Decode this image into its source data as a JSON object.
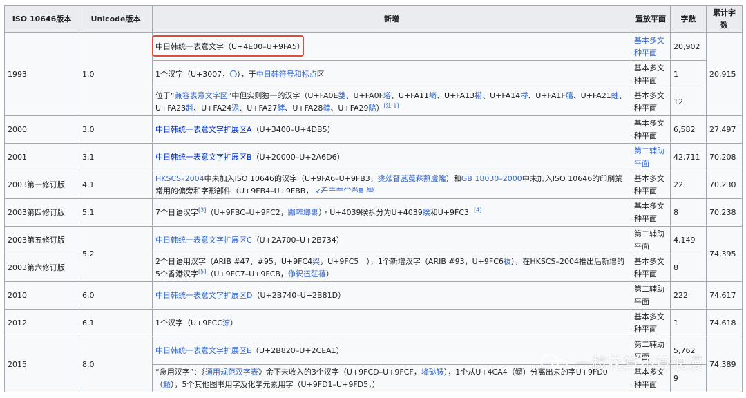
{
  "headers": [
    "ISO 10646版本",
    "Unicode版本",
    "新增",
    "置放平面",
    "字数",
    "累计字数"
  ],
  "rows": {
    "r1": {
      "iso": "1993",
      "uni": "1.0",
      "desc": "中日韩统一表意文字（U+4E00–U+9FA5）",
      "plane": "基本多文种平面",
      "count": "20,902",
      "cum": "20,915"
    },
    "r2": {
      "desc_a": "1个汉字（U+3007，",
      "circle": "〇",
      "desc_b": "），于",
      "link": "中日韩符号和标点",
      "desc_c": "区",
      "plane": "基本多文种平面",
      "count": "1"
    },
    "r3": {
      "desc_a": "位于“",
      "link": "兼容表意文字区",
      "desc_b": "”中但实则独一的汉字（U+FA0E",
      "c1": "﨎",
      "desc_c": "、U+FA0F",
      "c2": "﨏",
      "desc_d": "、U+FA11",
      "c3": "﨑",
      "desc_e": "、U+FA13",
      "c4": "﨓",
      "desc_f": "、U+FA14",
      "c5": "﨔",
      "desc_g": "、U+FA1F",
      "c6": "﨟",
      "desc_h": "、U+FA21",
      "c7": "﨡",
      "desc_i": "、U+FA23",
      "c8": "﨣",
      "desc_j": "、U+FA24",
      "c9": "﨤",
      "desc_k": "、U+FA27",
      "c10": "﨧",
      "desc_l": "、U+FA28",
      "c11": "﨨",
      "desc_m": "、U+FA29",
      "c12": "﨩",
      "desc_n": "）",
      "note": "[注 1]",
      "plane": "基本多文种平面",
      "count": "12"
    },
    "r4": {
      "iso": "2000",
      "uni": "3.0",
      "link": "中日韩统一表意文字扩展区A",
      "desc": "（U+3400–U+4DB5）",
      "plane": "基本多文种平面",
      "count": "6,582",
      "cum": "27,497"
    },
    "r5": {
      "iso": "2001",
      "uni": "3.1",
      "link": "中日韩统一表意文字扩展区B",
      "desc": "（U+20000–U+2A6D6）",
      "plane": "第二辅助平面",
      "count": "42,711",
      "cum": "70,208"
    },
    "r6": {
      "iso": "2003第一修订版",
      "uni": "4.1",
      "link1": "HKSCS–2004",
      "desc_a": "中未加入ISO 10646的汉字（U+9FA6–U+9FB3，",
      "chars": "㷭㿰䀾䓵䒶䔉䖄䖒䧯",
      "desc_b": "）和",
      "link2": "GB 18030–2000",
      "desc_c": "中未加入ISO 10646的印刷業常用的偏旁和字形部件（U+9FB4–U+9FBB，",
      "chars2": "龴龵龶龷龸龹龺龻",
      "plane": "基本多文种平面",
      "count": "22",
      "cum": "70,230"
    },
    "r7": {
      "iso": "2003第四修订版",
      "uni": "5.1",
      "desc_a": "7个日语汉字",
      "sup1": "[3]",
      "desc_b": "（U+9FBC–U+9FC2，",
      "chars": "鿼鿽鿾鿿",
      "desc_c": "），U+4039睽拆分为U+4039",
      "c1": "睽",
      "desc_d": "和U+9FC3",
      "sup2": "[4]",
      "plane": "基本多文种平面",
      "count": "8",
      "cum": "70,238"
    },
    "r8": {
      "iso": "2003第五修订版",
      "uni": "5.2",
      "link": "中日韩统一表意文字扩展区C",
      "desc": "（U+2A700–U+2B734）",
      "plane": "第二辅助平面",
      "count": "4,149",
      "cum": "74,395"
    },
    "r9": {
      "iso": "2003第六修订版",
      "desc_a": "2个日语用汉字（ARIB #47、#95，U+9FC4",
      "c1": "鿄",
      "desc_b": "，U+9FC5　），1个新增汉字（ARIB #93，U+9FC6",
      "c2": "鿆",
      "desc_c": "），在HKSCS–2004推出后新增的5个香港汉字",
      "sup": "[5]",
      "desc_d": "（U+9FC7–U+9FCB，",
      "chars": "鿇鿈鿉鿊鿋",
      "desc_e": "）",
      "plane": "基本多文种平面",
      "count": "8"
    },
    "r10": {
      "iso": "2010",
      "uni": "6.0",
      "link": "中日韩统一表意文字扩展区D",
      "desc": "（U+2B740–U+2B81D）",
      "plane": "第二辅助平面",
      "count": "222",
      "cum": "74,617"
    },
    "r11": {
      "iso": "2012",
      "uni": "6.1",
      "desc_a": "1个汉字（U+9FCC",
      "c1": "鿌",
      "desc_b": "）",
      "plane": "基本多文种平面",
      "count": "1",
      "cum": "74,618"
    },
    "r12": {
      "iso": "2015",
      "uni": "8.0",
      "link": "中日韩统一表意文字扩展区E",
      "desc": "（U+2B820–U+2CEA1）",
      "plane": "第二辅助平面",
      "count": "5,762",
      "cum": "74,389"
    },
    "r13": {
      "desc_a": "“急用汉字”：《",
      "link": "通用规范汉字表",
      "desc_b": "》余下未收入的3个汉字（U+9FCD–U+9FCF，",
      "chars": "鿍鿎鿏",
      "desc_c": "），1个从U+4CA4（䲤）分离出来的字U+9FD0（",
      "c1": "鿐",
      "desc_d": "），5个其他图书用字及化学元素用字（U+9FD1–U+9FD5，",
      "desc_e": "）",
      "plane": "基本多文种平面",
      "count": "9"
    }
  },
  "watermark": {
    "text": "一枝花算不算浪漫",
    "icon": "wechat-icon"
  },
  "colors": {
    "link": "#3366cc",
    "header_bg": "#eaecf0",
    "cell_bg": "#f8f9fa",
    "border": "#a2a9b1",
    "highlight": "#e04c3c"
  }
}
